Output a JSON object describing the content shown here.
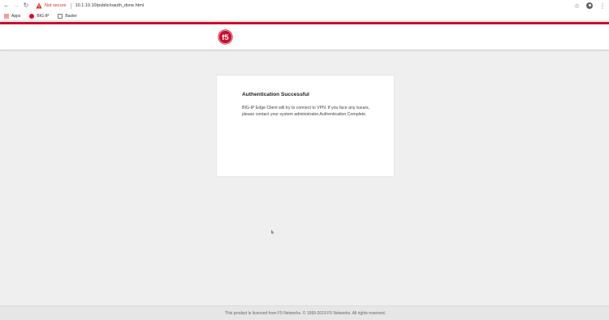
{
  "browser": {
    "security_label": "Not secure",
    "url": "10.1.10.10/public/oauth_done.html",
    "bookmarks": [
      {
        "label": "Apps",
        "icon": "apps-grid-icon"
      },
      {
        "label": "BIG-IP",
        "icon": "f5-favicon-icon"
      },
      {
        "label": "Baxter",
        "icon": "page-icon"
      }
    ]
  },
  "header": {
    "logo_alt": "f5",
    "accent_color": "#c8102e"
  },
  "card": {
    "title": "Authentication Successful",
    "message": "BIG-IP Edge Client will try to connect to VPN. If you face any issues, please contact your system administrator.Authentication Complete."
  },
  "footer": {
    "text": "This product is licensed from F5 Networks. © 1999-2019 F5 Networks. All rights reserved."
  }
}
